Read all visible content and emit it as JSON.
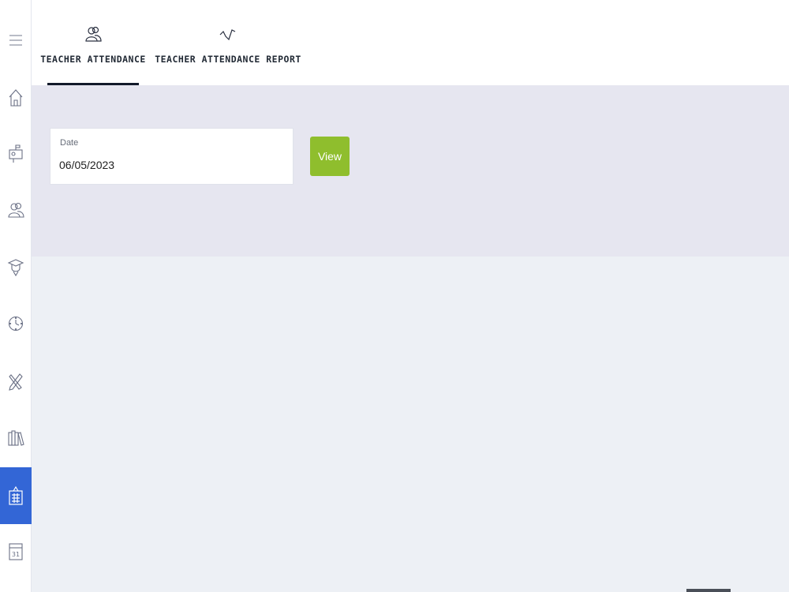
{
  "sidebar": {
    "items": [
      {
        "name": "menu-icon"
      },
      {
        "name": "home-icon"
      },
      {
        "name": "mailbox-icon"
      },
      {
        "name": "users-icon"
      },
      {
        "name": "graduate-icon"
      },
      {
        "name": "clock-icon"
      },
      {
        "name": "pencil-ruler-icon"
      },
      {
        "name": "books-icon"
      },
      {
        "name": "attendance-clipboard-icon",
        "active": true
      },
      {
        "name": "calendar-icon",
        "text": "31"
      }
    ],
    "active_color": "#3366d6"
  },
  "tabs": [
    {
      "label": "TEACHER ATTENDANCE",
      "icon": "users-icon",
      "active": true
    },
    {
      "label": "TEACHER ATTENDANCE REPORT",
      "icon": "activity-line-icon",
      "active": false
    }
  ],
  "filter": {
    "date_label": "Date",
    "date_value": "06/05/2023",
    "view_label": "View",
    "view_color": "#8fbe2d"
  }
}
